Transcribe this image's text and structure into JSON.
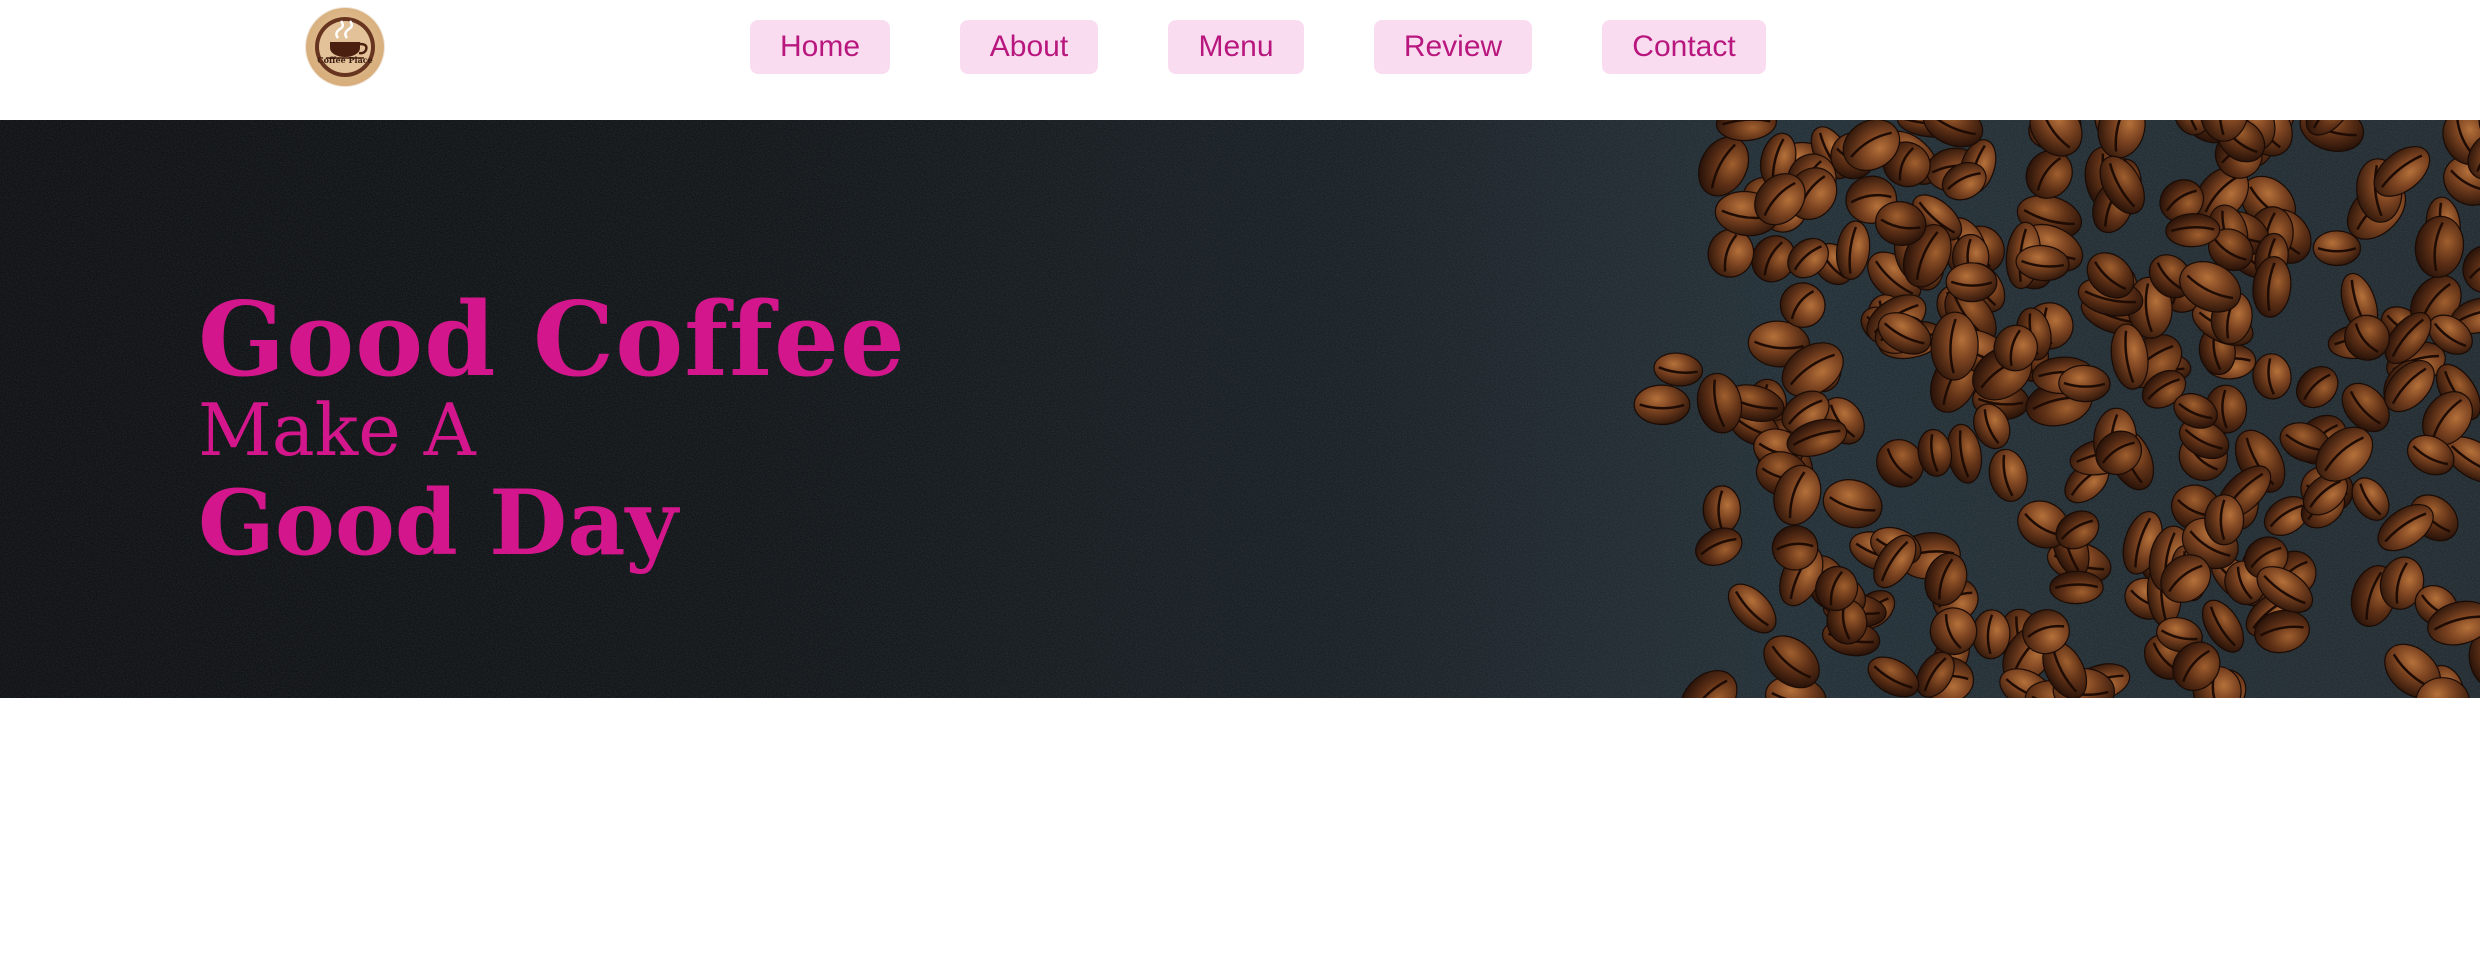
{
  "logo": {
    "text": "Coffee Place",
    "icon": "coffee-cup-icon"
  },
  "nav": {
    "items": [
      {
        "label": "Home"
      },
      {
        "label": "About"
      },
      {
        "label": "Menu"
      },
      {
        "label": "Review"
      },
      {
        "label": "Contact"
      }
    ]
  },
  "hero": {
    "line1": "Good Coffee",
    "line2": "Make A",
    "line3": "Good Day",
    "image": "coffee-beans-image"
  },
  "colors": {
    "accent": "#d4168c",
    "nav_bg": "#fadcf1",
    "nav_text": "#b8187e",
    "hero_bg": "#0b0e11"
  }
}
